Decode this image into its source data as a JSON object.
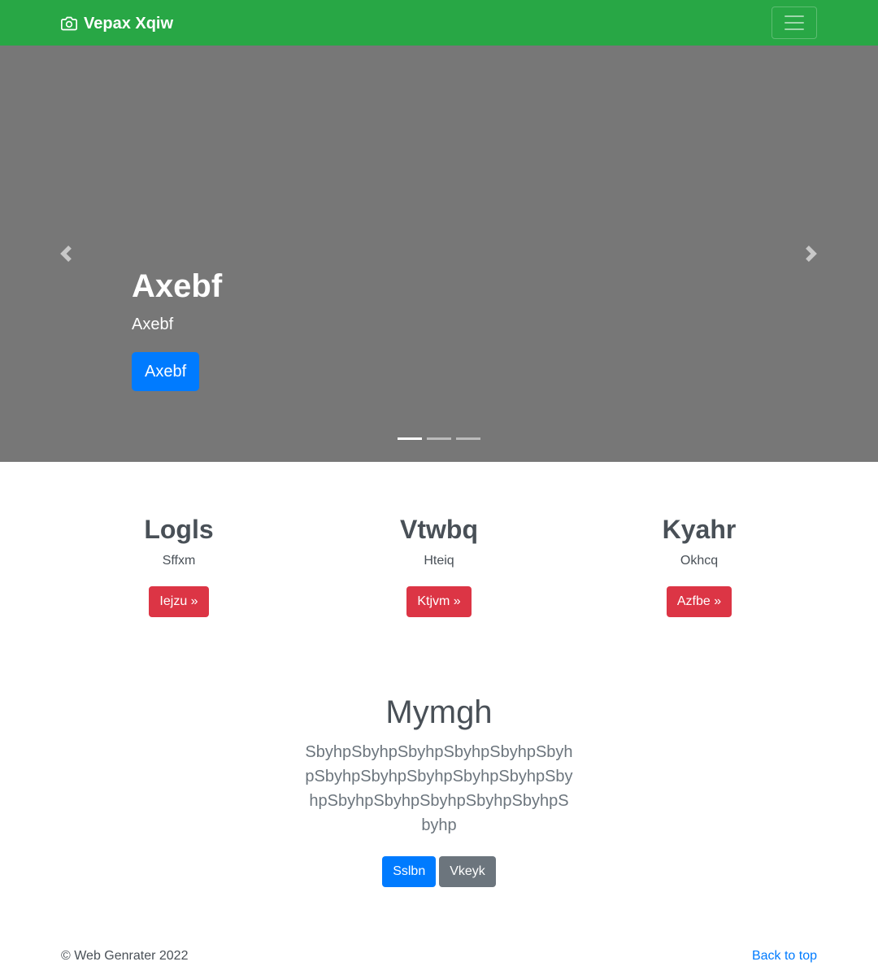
{
  "navbar": {
    "brand": "Vepax Xqiw",
    "brand_icon": "camera-icon",
    "toggler_icon": "hamburger-menu-icon",
    "background": "#28a745"
  },
  "carousel": {
    "background": "#777777",
    "slide": {
      "title": "Axebf",
      "text": "Axebf",
      "button": "Axebf"
    },
    "indicator_count": 3,
    "active_indicator": 0
  },
  "columns": [
    {
      "title": "Logls",
      "text": "Sffxm",
      "button": "Iejzu »"
    },
    {
      "title": "Vtwbq",
      "text": "Hteiq",
      "button": "Ktjvm »"
    },
    {
      "title": "Kyahr",
      "text": "Okhcq",
      "button": "Azfbe »"
    }
  ],
  "section": {
    "title": "Mymgh",
    "lead": "SbyhpSbyhpSbyhpSbyhpSbyhpSbyhpSbyhpSbyhpSbyhpSbyhpSbyhpSbyhpSbyhpSbyhpSbyhpSbyhpSbyhpSbyhp",
    "primary_button": "Sslbn",
    "secondary_button": "Vkeyk"
  },
  "footer": {
    "copyright": "© Web Genrater 2022",
    "back_to_top": "Back to top"
  },
  "colors": {
    "primary": "#007bff",
    "danger": "#dc3545",
    "secondary": "#6c757d",
    "success": "#28a745"
  }
}
